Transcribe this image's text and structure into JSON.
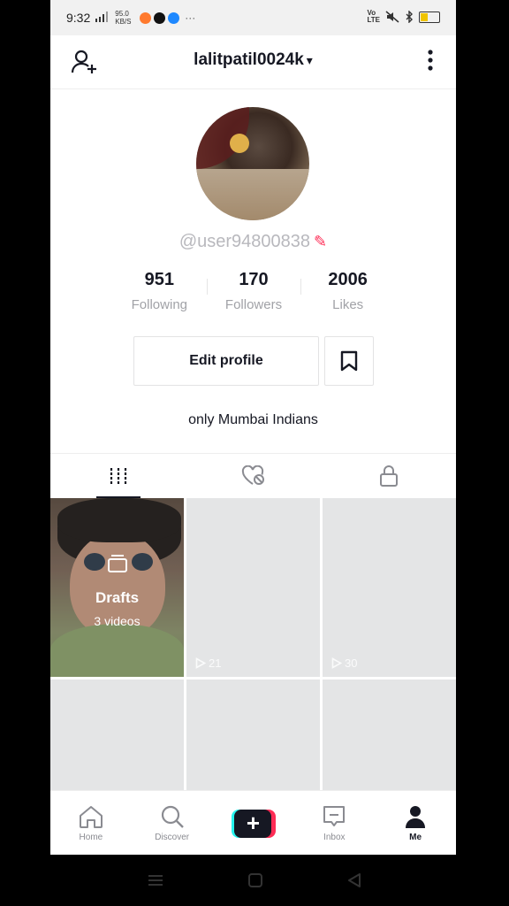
{
  "status_bar": {
    "time": "9:32",
    "network_speed": "95.0 KB/S",
    "more": "···",
    "colors": {
      "battery": "#f0c400"
    }
  },
  "header": {
    "title": "lalitpatil0024k",
    "dropdown_glyph": "▾"
  },
  "profile": {
    "username": "@user94800838",
    "stats": [
      {
        "value": "951",
        "label": "Following"
      },
      {
        "value": "170",
        "label": "Followers"
      },
      {
        "value": "2006",
        "label": "Likes"
      }
    ],
    "edit_button": "Edit profile",
    "bio": "only Mumbai Indians"
  },
  "tabs": [
    {
      "icon": "grid-icon",
      "active": true
    },
    {
      "icon": "liked-private-icon",
      "active": false
    },
    {
      "icon": "lock-icon",
      "active": false
    }
  ],
  "grid": {
    "drafts_label": "Drafts",
    "drafts_count": "3 videos",
    "views": [
      "21",
      "30"
    ]
  },
  "bottom_nav": {
    "items": [
      {
        "label": "Home",
        "icon": "home-icon"
      },
      {
        "label": "Discover",
        "icon": "search-icon"
      },
      {
        "label": "",
        "icon": "create-plus-icon"
      },
      {
        "label": "Inbox",
        "icon": "inbox-icon"
      },
      {
        "label": "Me",
        "icon": "profile-icon"
      }
    ],
    "plus": "+"
  },
  "colors": {
    "accent": "#fe2c55",
    "cyan": "#25f4ee",
    "text": "#161823",
    "muted": "#a1a2a7"
  }
}
